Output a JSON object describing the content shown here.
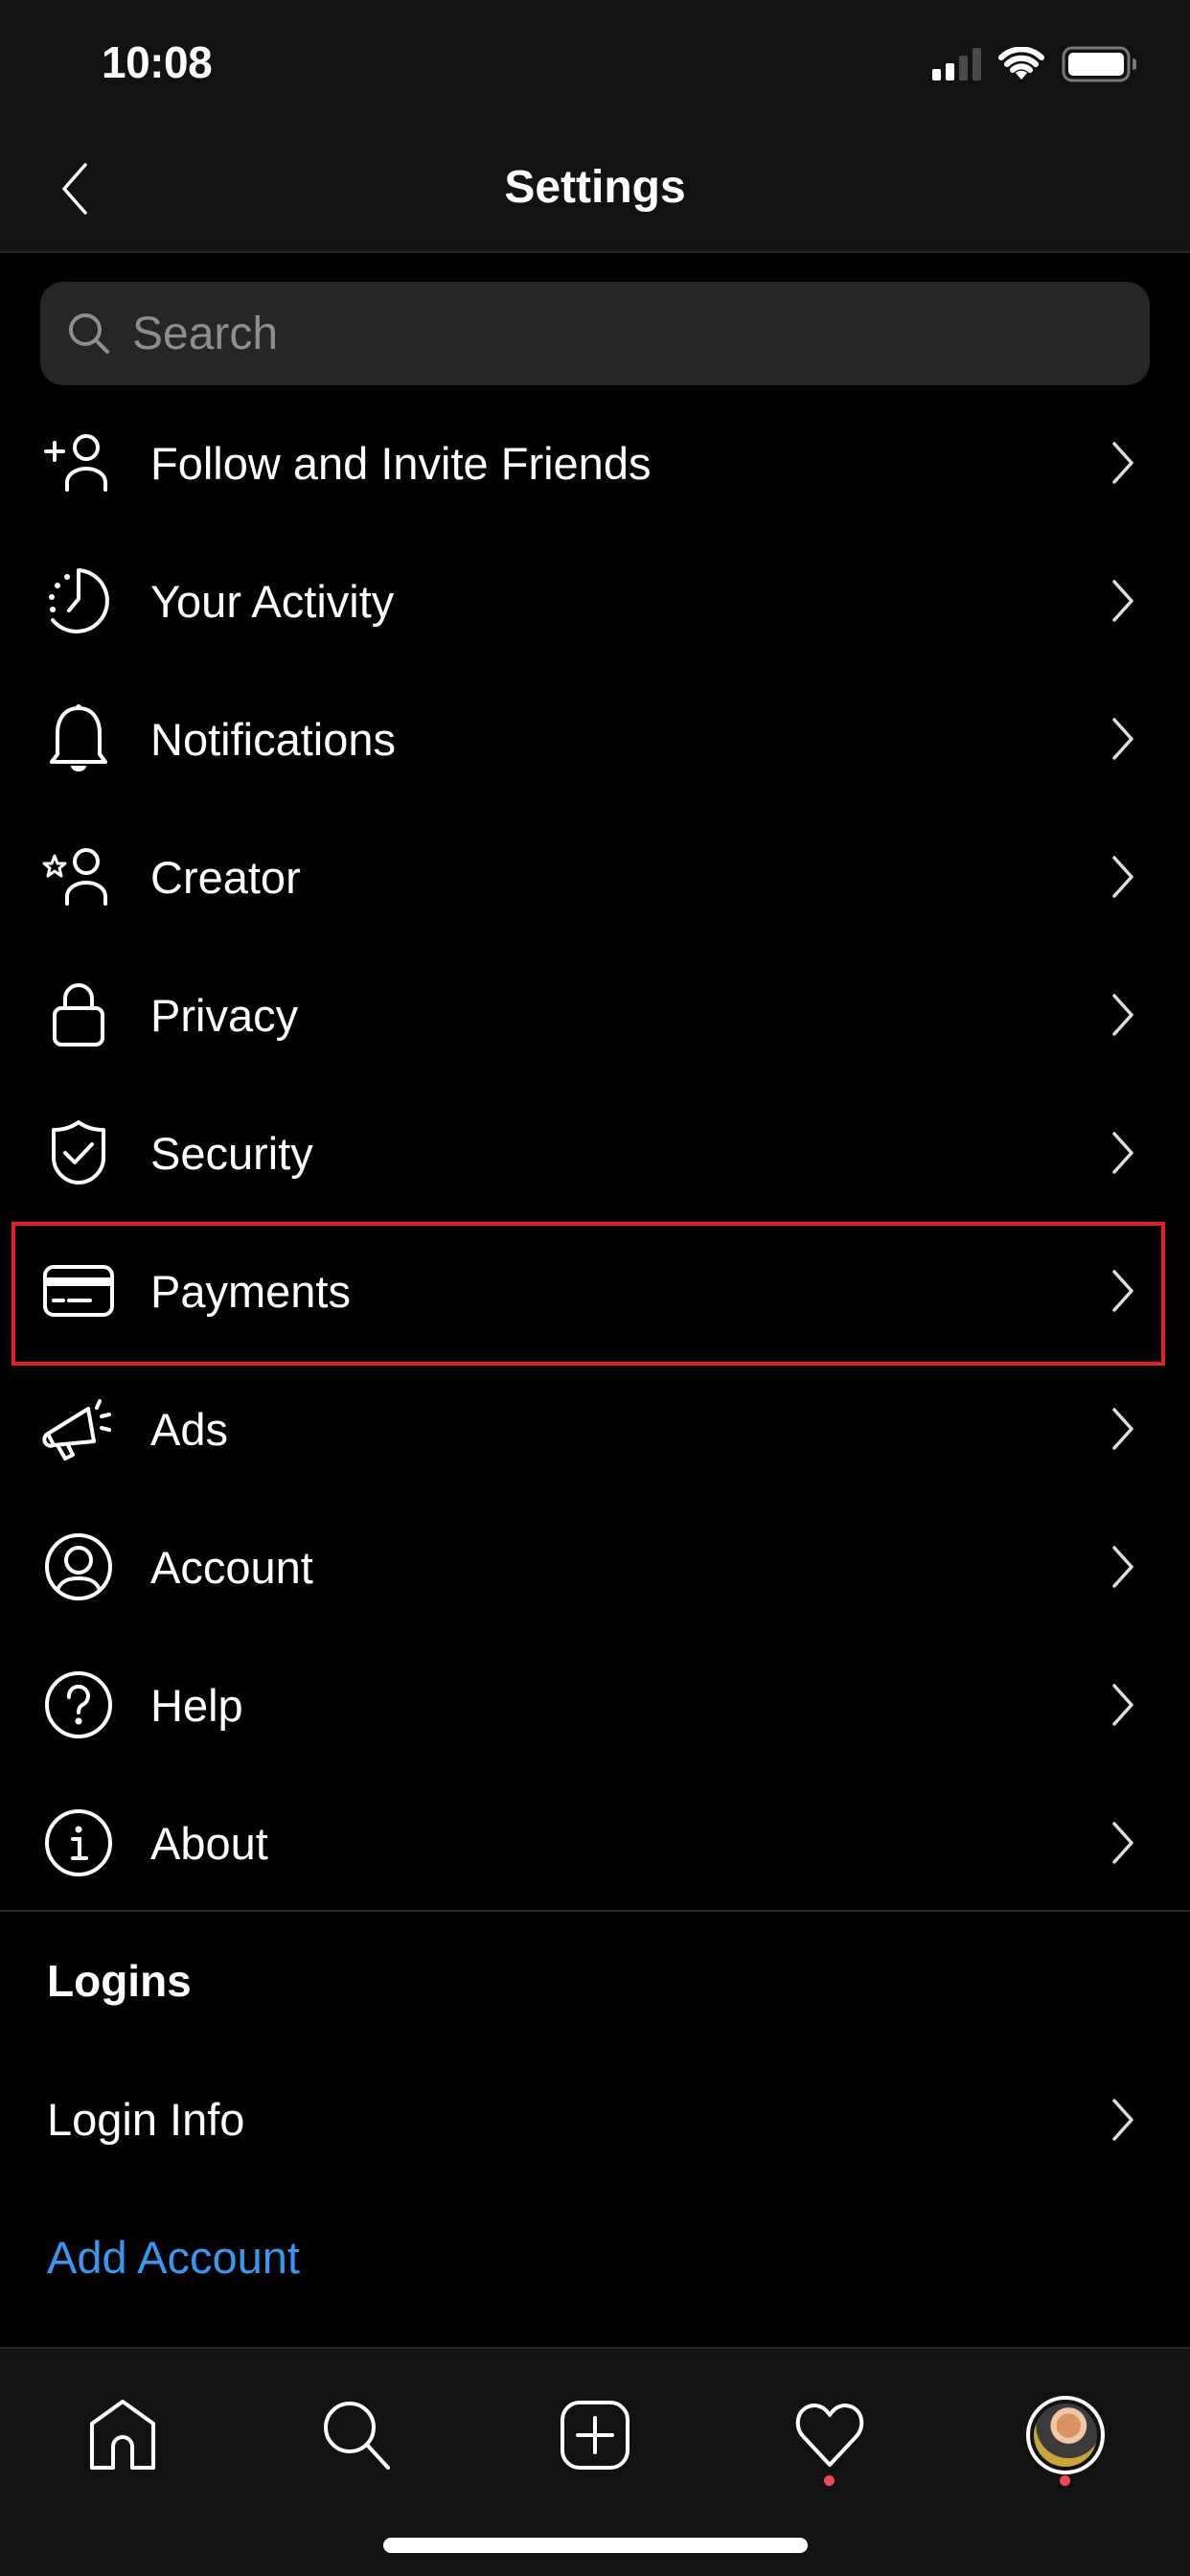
{
  "status_bar": {
    "time": "10:08",
    "signal_bars_active": 2,
    "signal_bars_total": 4,
    "wifi": "wifi-icon",
    "battery_level_percent": 100
  },
  "header": {
    "title": "Settings",
    "back_icon": "chevron-left-icon"
  },
  "search": {
    "placeholder": "Search",
    "value": "",
    "icon": "search-icon"
  },
  "menu": {
    "items": [
      {
        "label": "Follow and Invite Friends",
        "icon": "add-person-icon"
      },
      {
        "label": "Your Activity",
        "icon": "activity-clock-icon"
      },
      {
        "label": "Notifications",
        "icon": "bell-icon"
      },
      {
        "label": "Creator",
        "icon": "creator-star-person-icon"
      },
      {
        "label": "Privacy",
        "icon": "lock-icon"
      },
      {
        "label": "Security",
        "icon": "shield-check-icon"
      },
      {
        "label": "Payments",
        "icon": "credit-card-icon",
        "highlighted": true
      },
      {
        "label": "Ads",
        "icon": "megaphone-icon"
      },
      {
        "label": "Account",
        "icon": "account-circle-icon"
      },
      {
        "label": "Help",
        "icon": "help-circle-icon"
      },
      {
        "label": "About",
        "icon": "info-circle-icon"
      }
    ]
  },
  "logins": {
    "section_title": "Logins",
    "login_info_label": "Login Info",
    "add_account_label": "Add Account"
  },
  "tab_bar": {
    "tabs": [
      {
        "name": "home",
        "icon": "home-icon",
        "badge": false
      },
      {
        "name": "search",
        "icon": "search-icon",
        "badge": false
      },
      {
        "name": "new-post",
        "icon": "add-post-icon",
        "badge": false
      },
      {
        "name": "activity",
        "icon": "heart-icon",
        "badge": true
      },
      {
        "name": "profile",
        "icon": "profile-avatar",
        "badge": true
      }
    ]
  },
  "colors": {
    "background": "#000000",
    "bar_background": "#121212",
    "search_background": "#262626",
    "link_blue": "#3897f0",
    "highlight_red": "#e61e2a",
    "badge_red": "#ed4956"
  }
}
